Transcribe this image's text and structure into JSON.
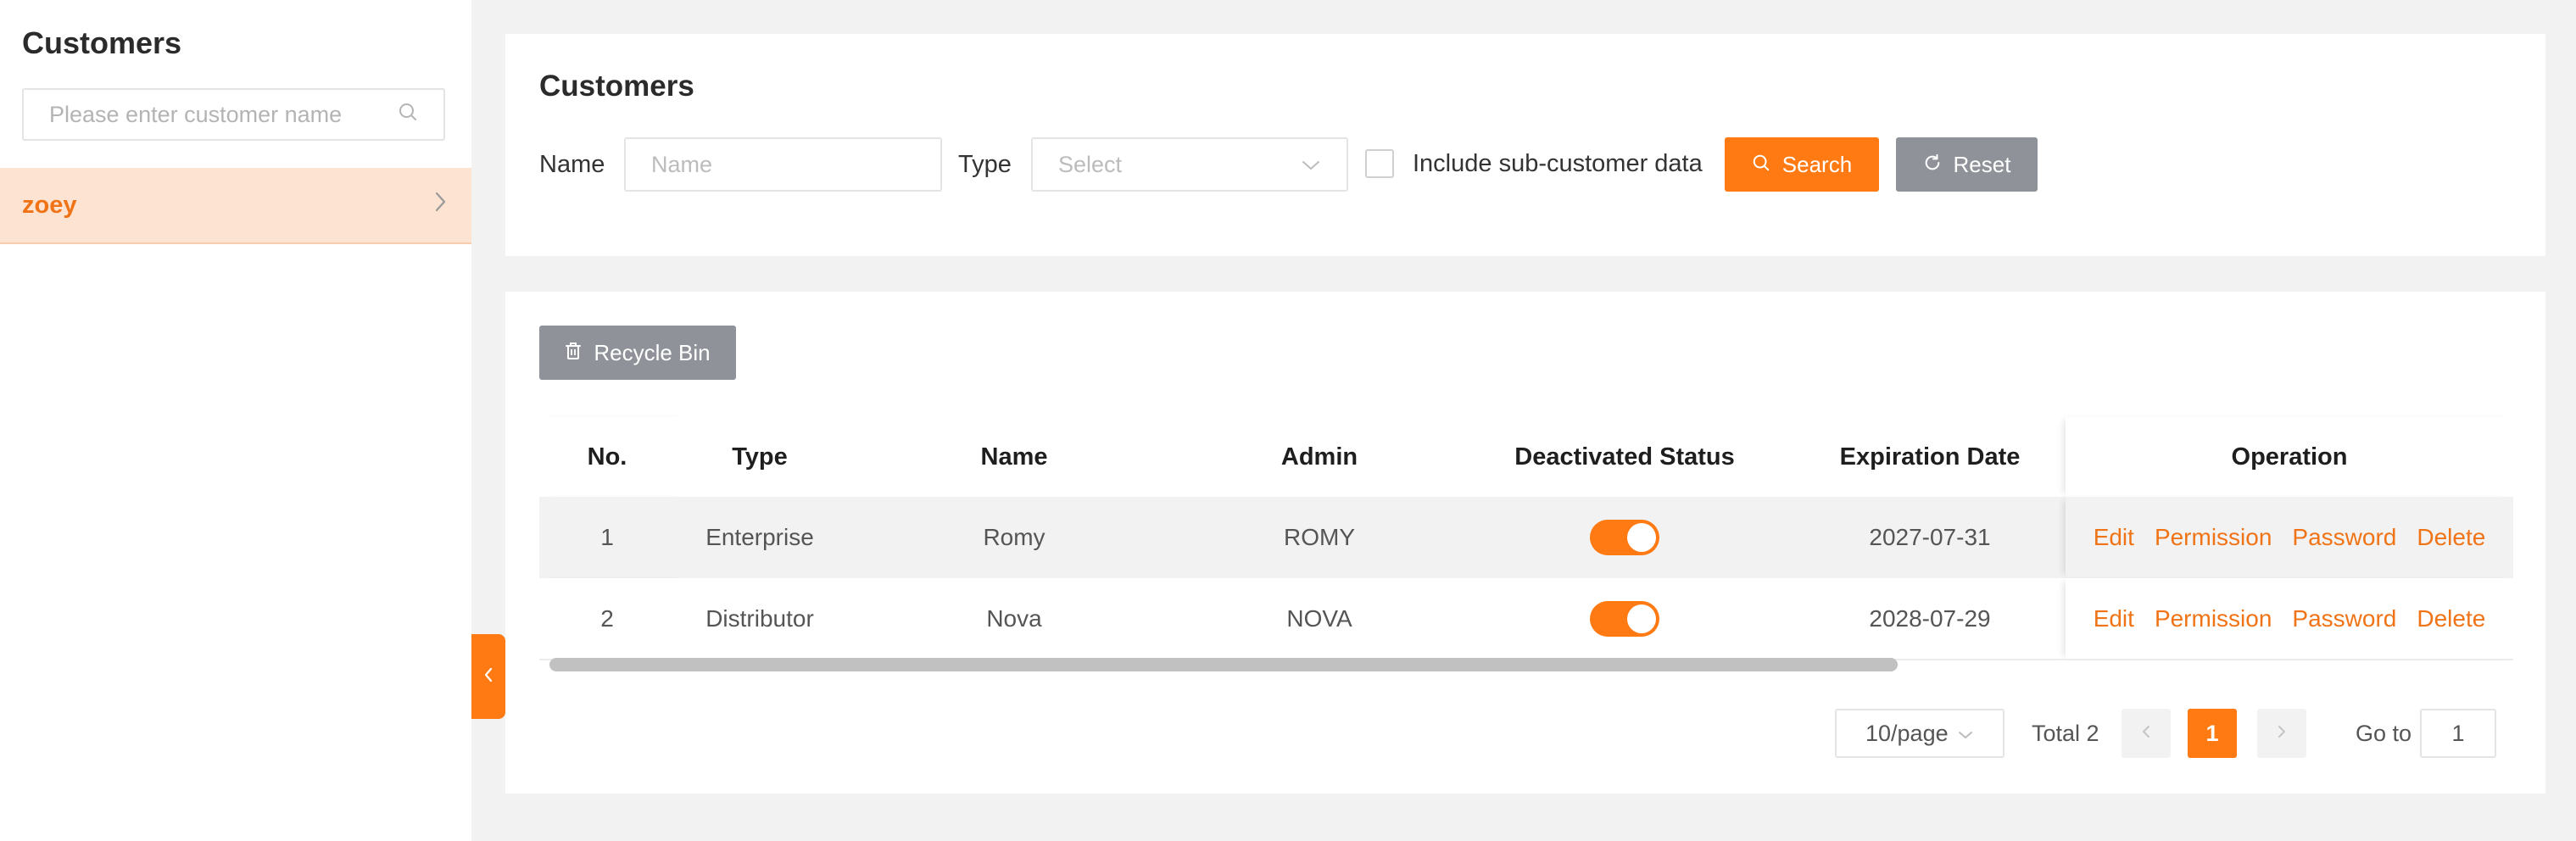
{
  "sidebar": {
    "title": "Customers",
    "search_placeholder": "Please enter customer name",
    "items": [
      {
        "label": "zoey",
        "selected": true
      }
    ]
  },
  "filter": {
    "title": "Customers",
    "name_label": "Name",
    "name_placeholder": "Name",
    "type_label": "Type",
    "type_placeholder": "Select",
    "include_sub_label": "Include sub-customer data",
    "include_sub_checked": false,
    "search_button": "Search",
    "reset_button": "Reset"
  },
  "toolbar": {
    "recycle_bin_button": "Recycle Bin"
  },
  "table": {
    "columns": [
      "No.",
      "Type",
      "Name",
      "Admin",
      "Deactivated Status",
      "Expiration Date",
      "Operation"
    ],
    "rows": [
      {
        "no": "1",
        "type": "Enterprise",
        "name": "Romy",
        "admin": "ROMY",
        "deactivated_on": true,
        "expiration": "2027-07-31"
      },
      {
        "no": "2",
        "type": "Distributor",
        "name": "Nova",
        "admin": "NOVA",
        "deactivated_on": true,
        "expiration": "2028-07-29"
      }
    ],
    "operations": [
      "Edit",
      "Permission",
      "Password",
      "Delete"
    ]
  },
  "pagination": {
    "page_size": "10/page",
    "total": "Total 2",
    "current_page": "1",
    "goto_label": "Go to",
    "goto_value": "1"
  },
  "colors": {
    "accent": "#ff7a12",
    "accent_text": "#f07417",
    "selected_bg": "#fde4d2",
    "gray_button": "#8f9399"
  },
  "icons": {
    "search": "search-icon",
    "chevron_right": "chevron-right-icon",
    "chevron_left": "chevron-left-icon",
    "chevron_down": "chevron-down-icon",
    "reset": "refresh-icon",
    "trash": "trash-icon"
  }
}
